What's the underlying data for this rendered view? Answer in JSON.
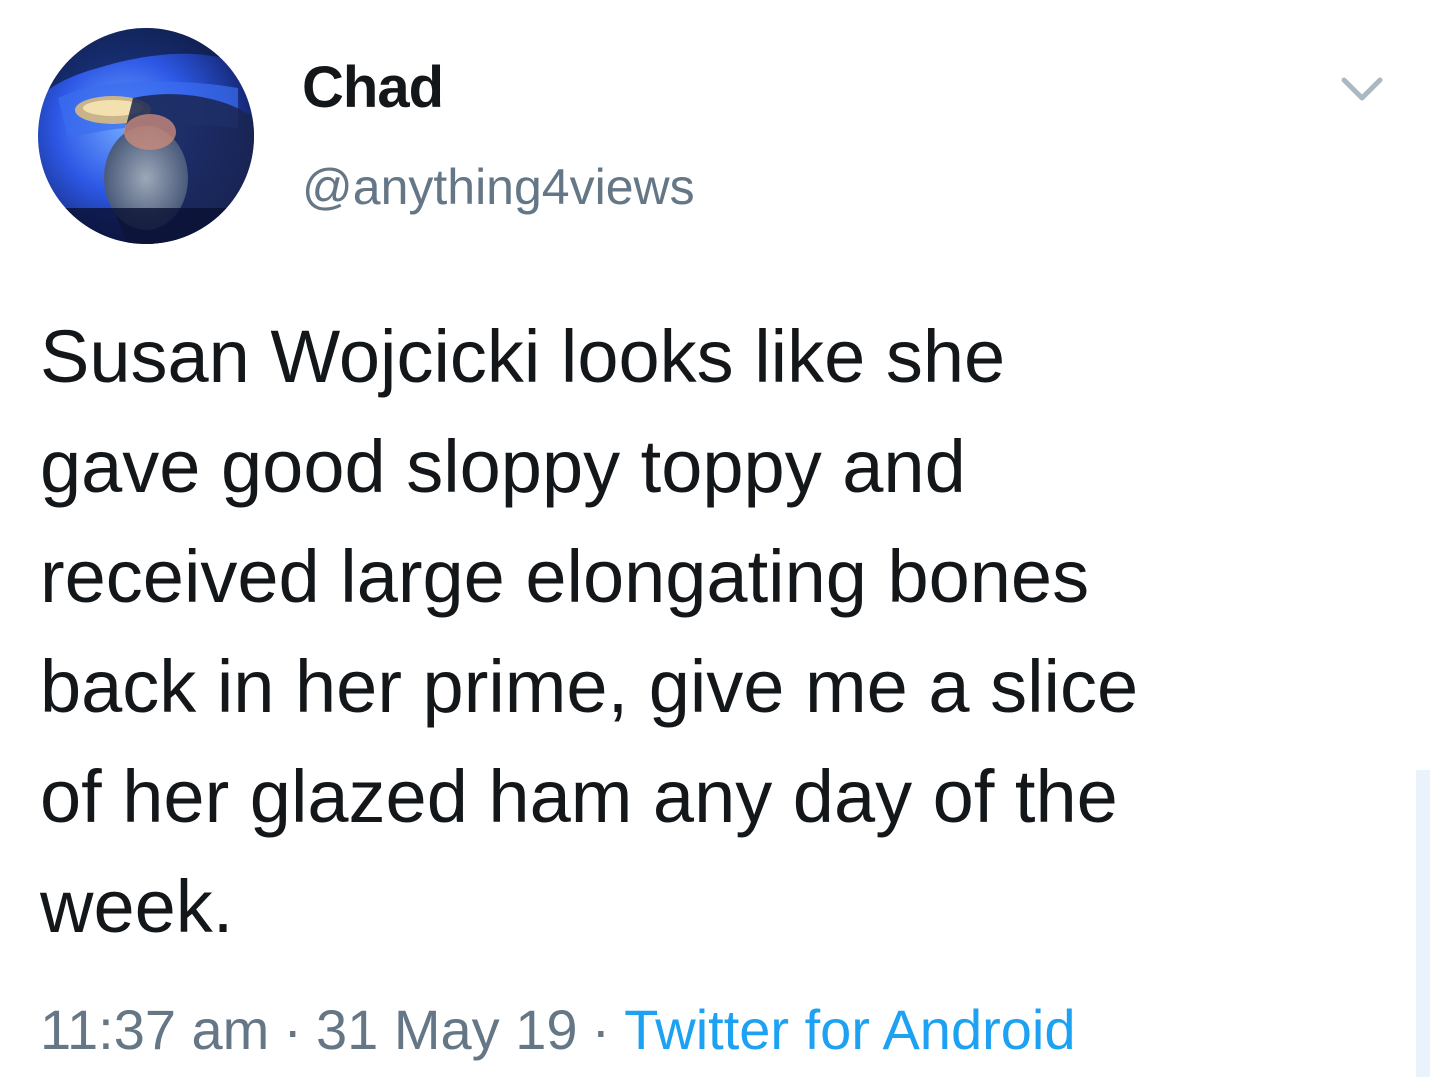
{
  "tweet": {
    "display_name": "Chad",
    "handle": "@anything4views",
    "text": "Susan Wojcicki looks like she\ngave good sloppy toppy and\nreceived large elongating bones\nback in her prime, give me a slice\nof her glazed ham any day of the\nweek.",
    "time": "11:37 am",
    "separator": "·",
    "date": "31 May 19",
    "source": "Twitter for Android"
  },
  "icons": {
    "avatar": "avatar-image",
    "menu": "chevron-down-icon"
  },
  "colors": {
    "text": "#14171a",
    "secondary": "#657786",
    "link": "#1da1f2",
    "chevron": "#aab8c2"
  }
}
